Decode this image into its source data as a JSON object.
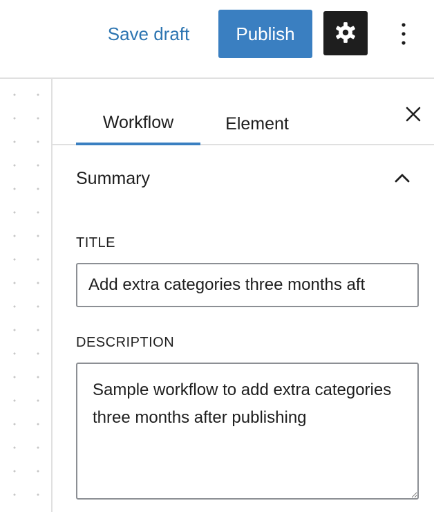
{
  "header": {
    "save_draft_label": "Save draft",
    "publish_label": "Publish",
    "settings_icon": "gear-icon",
    "more_icon": "vertical-ellipsis-icon"
  },
  "sidebar": {
    "tabs": [
      {
        "label": "Workflow",
        "active": true
      },
      {
        "label": "Element",
        "active": false
      }
    ],
    "close_icon": "close-icon",
    "panel": {
      "title": "Summary",
      "collapse_icon": "chevron-up-icon",
      "title_field": {
        "label": "TITLE",
        "value": "Add extra categories three months aft"
      },
      "description_field": {
        "label": "DESCRIPTION",
        "value": "Sample workflow to add extra categories three months after publishing"
      }
    }
  },
  "colors": {
    "accent": "#3a7fc1",
    "link": "#2d75b1",
    "dark_button": "#1e1e1e",
    "border": "#e0e0e0",
    "input_border": "#8c8f94"
  }
}
